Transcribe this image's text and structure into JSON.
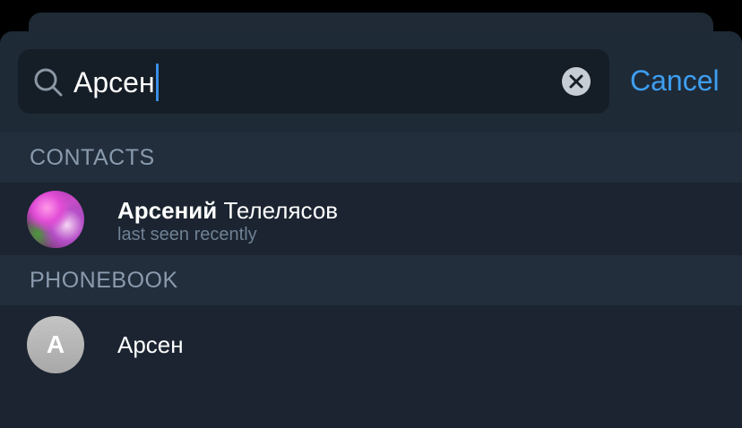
{
  "search": {
    "query": "Арсен",
    "cancel_label": "Cancel"
  },
  "sections": {
    "contacts_header": "CONTACTS",
    "phonebook_header": "PHONEBOOK"
  },
  "contacts": [
    {
      "name_first": "Арсений",
      "name_last": "Телелясов",
      "status": "last seen recently"
    }
  ],
  "phonebook": [
    {
      "name": "Арсен",
      "avatar_letter": "A"
    }
  ],
  "colors": {
    "accent": "#3d9ff0",
    "background": "#1b2430",
    "section_header": "#222e3c"
  },
  "icons": {
    "search": "search-icon",
    "clear": "clear-icon"
  }
}
